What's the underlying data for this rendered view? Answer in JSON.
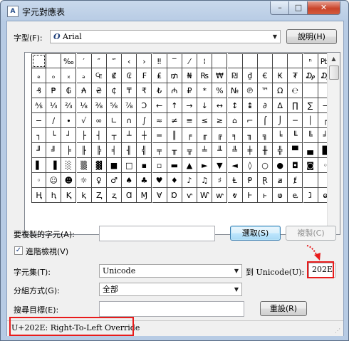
{
  "window": {
    "title": "字元對應表",
    "app_icon_glyph": "A",
    "minimize_glyph": "–",
    "maximize_glyph": "□",
    "close_glyph": "✕"
  },
  "font_row": {
    "label": "字型(F):",
    "font_icon_glyph": "O",
    "value": "Arial",
    "help_button": "說明(H)"
  },
  "grid": {
    "columns": 20,
    "selected_index": 0,
    "rows": [
      [
        "",
        "",
        "‰",
        "′",
        "″",
        "‴",
        "‹",
        "›",
        "‼",
        "‾",
        "⁄",
        "⁞",
        "",
        "",
        "",
        "",
        "",
        "",
        "ⁿ",
        "₧"
      ],
      [
        "ₑ",
        "ₒ",
        "ₓ",
        "ₔ",
        "₠",
        "₡",
        "₢",
        "₣",
        "₤",
        "₥",
        "₦",
        "₨",
        "₩",
        "₪",
        "₫",
        "€",
        "₭",
        "₮",
        "₯",
        "₯"
      ],
      [
        "₰",
        "₱",
        "₲",
        "₳",
        "₴",
        "₵",
        "₸",
        "₹",
        "₺",
        "₼",
        "₽",
        "*",
        "%",
        "№",
        "℗",
        "™",
        "Ω",
        "℮",
        "",
        ""
      ],
      [
        "⅍",
        "⅓",
        "⅔",
        "⅛",
        "⅜",
        "⅝",
        "⅞",
        "Ↄ",
        "←",
        "↑",
        "→",
        "↓",
        "↔",
        "↕",
        "↨",
        "∂",
        "∆",
        "∏",
        "∑",
        "−"
      ],
      [
        "−",
        "∕",
        "∙",
        "√",
        "∞",
        "∟",
        "∩",
        "∫",
        "≈",
        "≠",
        "≡",
        "≤",
        "≥",
        "⌂",
        "⌐",
        "⌠",
        "⌡",
        "─",
        "│",
        "┌"
      ],
      [
        "┐",
        "└",
        "┘",
        "├",
        "┤",
        "┬",
        "┴",
        "┼",
        "═",
        "║",
        "╒",
        "╓",
        "╔",
        "╕",
        "╖",
        "╗",
        "╘",
        "╙",
        "╚",
        "╛"
      ],
      [
        "╜",
        "╝",
        "╞",
        "╟",
        "╠",
        "╡",
        "╢",
        "╣",
        "╤",
        "╥",
        "╦",
        "╧",
        "╨",
        "╩",
        "╪",
        "╫",
        "╬",
        "▀",
        "▄",
        "█"
      ],
      [
        "▌",
        "▐",
        "░",
        "▒",
        "▓",
        "■",
        "□",
        "▪",
        "▫",
        "▬",
        "▲",
        "►",
        "▼",
        "◄",
        "◊",
        "○",
        "●",
        "◘",
        "◙",
        "◦"
      ],
      [
        "◦",
        "☺",
        "☻",
        "☼",
        "♀",
        "♂",
        "♠",
        "♣",
        "♥",
        "♦",
        "♪",
        "♫",
        "♯",
        "Ⱡ",
        "Ᵽ",
        "Ɽ",
        "ⱥ",
        "ⱦ",
        "",
        ""
      ],
      [
        "Ⱨ",
        "ⱨ",
        "Ⱪ",
        "ⱪ",
        "Ⱬ",
        "ⱬ",
        "Ɑ",
        "Ɱ",
        "Ɐ",
        "Ɒ",
        "ⱱ",
        "Ⱳ",
        "ⱳ",
        "ⱴ",
        "Ⱶ",
        "ⱶ",
        "ⱷ",
        "ⱸ",
        "ⱹ",
        "ⱺ"
      ]
    ]
  },
  "scroll": {
    "up_glyph": "▲",
    "down_glyph": "▼"
  },
  "copy_row": {
    "label": "要複製的字元(A):",
    "value": "",
    "select_button": "選取(S)",
    "copy_button": "複製(C)"
  },
  "advanced": {
    "checked_glyph": "✓",
    "label": "進階檢視(V)"
  },
  "charset_row": {
    "label": "字元集(T):",
    "value": "Unicode",
    "goto_label": "到 Unicode(U):",
    "goto_value": "202E"
  },
  "group_row": {
    "label": "分組方式(G):",
    "value": "全部"
  },
  "search_row": {
    "label": "搜尋目標(E):",
    "value": "",
    "search_button": "重設(R)"
  },
  "dropdown_arrow": "▼",
  "status": {
    "text": "U+202E: Right-To-Left Override",
    "grip_glyph": "⋰"
  },
  "annotation": {
    "color": "#e81b1b"
  }
}
